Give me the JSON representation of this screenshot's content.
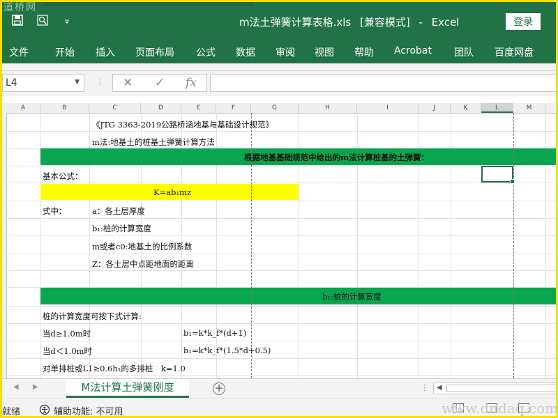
{
  "window": {
    "filename": "m法土弹簧计算表格.xls",
    "mode": "[兼容模式]",
    "separator": "-",
    "app": "Excel",
    "login_label": "登录",
    "watermark_top": "道桥网"
  },
  "menu": [
    "文件",
    "开始",
    "插入",
    "页面布局",
    "公式",
    "数据",
    "审阅",
    "视图",
    "帮助",
    "Acrobat",
    "团队",
    "百度网盘"
  ],
  "formula_bar": {
    "name_box": "L4",
    "cancel": "✕",
    "enter": "✓",
    "fx": "fx",
    "content": ""
  },
  "columns": [
    "A",
    "B",
    "C",
    "D",
    "E",
    "F",
    "G",
    "H",
    "I",
    "J",
    "K",
    "L",
    "M"
  ],
  "selected_column": "L",
  "cells": {
    "r1": "《JTG 3363-2019公路桥涵地基与基础设计规范》",
    "r2": "m法:地基土的桩基土弹簧计算方法",
    "r3": "根据地基基础规范中给出的m法计算桩基的土弹簧：",
    "r4": "基本公式：",
    "formula": "K=ab₁mz",
    "r6_label": "式中：",
    "r6": "a：各土层厚度",
    "r7": "b₁:桩的计算宽度",
    "r8": "m或者c0:地基土的比例系数",
    "r9": "Z：各土层中点距地面的距离",
    "r11": "b₁:桩的计算宽度",
    "r12": "桩的计算宽度可按下式计算:",
    "r13_cond": "当d≥1.0m时",
    "r13_formula": "b₁=k*k_f*(d+1)",
    "r14_cond": "当d＜1.0m时",
    "r14_formula": "b₁=k*k_f*(1.5*d+0.5)",
    "r15": "对单排桩或L1≥0.6h₁的多排桩　k=1.0"
  },
  "sheet": {
    "tab_name": "M法计算土弹簧刚度",
    "add": "+"
  },
  "status": {
    "ready": "就绪",
    "accessibility": "辅助功能: 不可用",
    "watermark": "www.dndaq.com"
  },
  "colors": {
    "excel_green": "#217346",
    "band_green": "#0aa64f",
    "band_yellow": "#ffff00",
    "frame": "#f2e100"
  }
}
